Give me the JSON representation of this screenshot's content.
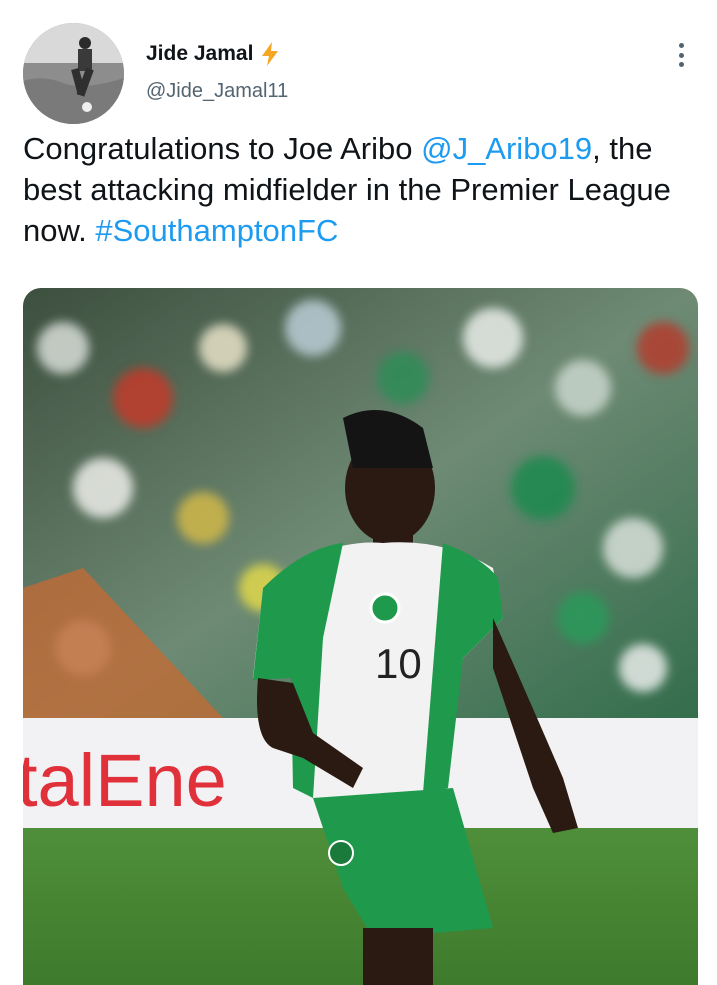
{
  "author": {
    "display_name": "Jide Jamal",
    "handle": "@Jide_Jamal11",
    "badge_icon": "lightning-bolt-icon"
  },
  "tweet": {
    "text_before": "Congratulations to Joe Aribo ",
    "mention": "@J_Aribo19",
    "text_middle": ", the best attacking midfielder in the Premier League now. ",
    "hashtag": "#SouthamptonFC"
  },
  "media": {
    "board_text": "talEne",
    "shirt_number": "10"
  },
  "colors": {
    "link": "#1d9bf0",
    "secondary_text": "#536471",
    "badge": "#f5a623",
    "kit_green": "#1f9a4d"
  }
}
